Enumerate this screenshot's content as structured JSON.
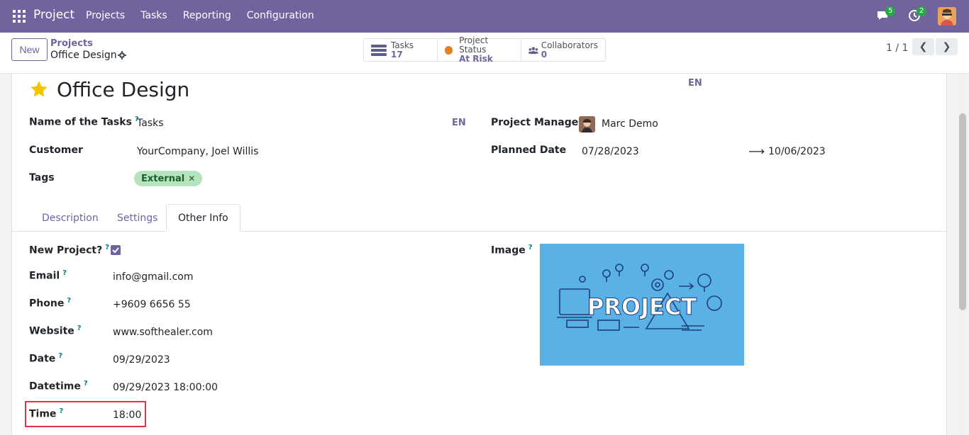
{
  "navbar": {
    "brand": "Project",
    "menu": [
      "Projects",
      "Tasks",
      "Reporting",
      "Configuration"
    ],
    "messages_count": "5",
    "activities_count": "2"
  },
  "control": {
    "new_label": "New",
    "breadcrumb_parent": "Projects",
    "breadcrumb_current": "Office Design",
    "stats": [
      {
        "label": "Tasks",
        "value": "17",
        "icon": "tasks-icon"
      },
      {
        "label": "Project Status",
        "value": "At Risk",
        "icon": "status-dot-icon"
      },
      {
        "label": "Collaborators",
        "value": "0",
        "icon": "users-icon"
      }
    ],
    "pager": "1 / 1"
  },
  "form": {
    "title": "Office Design",
    "title_lang": "EN",
    "name_tasks_label": "Name of the Tasks",
    "name_tasks_value": "Tasks",
    "name_tasks_lang": "EN",
    "customer_label": "Customer",
    "customer_value": "YourCompany, Joel Willis",
    "tags_label": "Tags",
    "tag_value": "External",
    "manager_label": "Project Manager",
    "manager_value": "Marc Demo",
    "planned_label": "Planned Date",
    "planned_start": "07/28/2023",
    "planned_end": "10/06/2023",
    "help_mark": "?"
  },
  "tabs": [
    "Description",
    "Settings",
    "Other Info"
  ],
  "other_info": {
    "new_project_label": "New Project?",
    "email_label": "Email",
    "email_value": "info@gmail.com",
    "phone_label": "Phone",
    "phone_value": "+9609 6656 55",
    "website_label": "Website",
    "website_value": "www.softhealer.com",
    "date_label": "Date",
    "date_value": "09/29/2023",
    "datetime_label": "Datetime",
    "datetime_value": "09/29/2023 18:00:00",
    "time_label": "Time",
    "time_value": "18:00",
    "image_label": "Image",
    "image_text": "PROJECT"
  },
  "colors": {
    "brand": "#71639e",
    "highlight": "#dc3545",
    "tag_bg": "#b5e3bd",
    "image_bg": "#5ab1e6"
  }
}
